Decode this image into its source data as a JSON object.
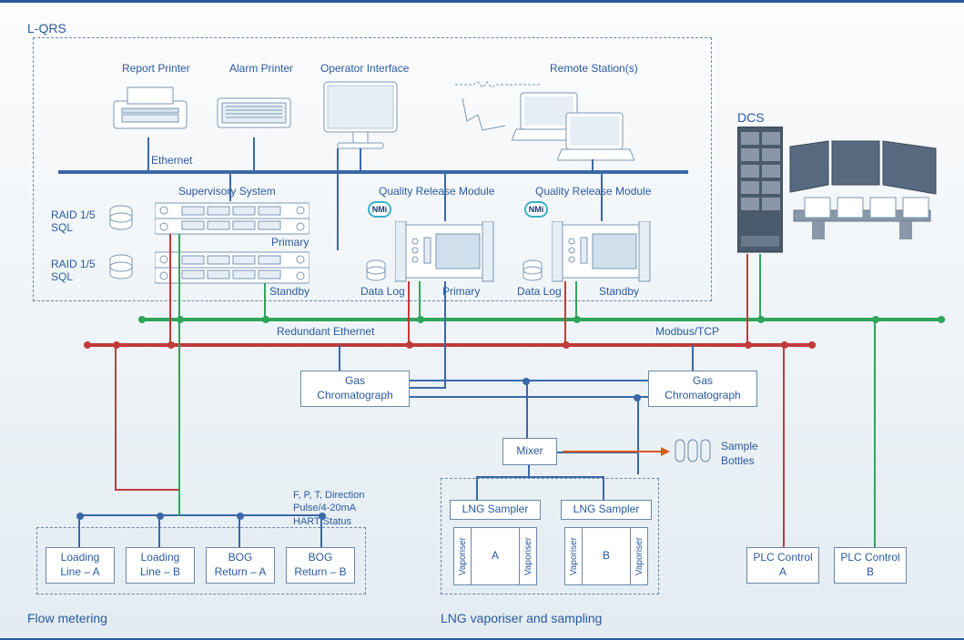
{
  "title": "L-QRS",
  "sections": {
    "lqrs": "L-QRS",
    "flow_metering": "Flow metering",
    "lng_vaporiser": "LNG vaporiser and sampling",
    "dcs": "DCS"
  },
  "top_equipment": {
    "report_printer": "Report Printer",
    "alarm_printer": "Alarm Printer",
    "operator_interface": "Operator Interface",
    "remote_stations": "Remote Station(s)"
  },
  "networks": {
    "ethernet": "Ethernet",
    "redundant_ethernet": "Redundant Ethernet",
    "modbus_tcp": "Modbus/TCP"
  },
  "supervisory": {
    "title": "Supervisory System",
    "raid": "RAID 1/5\nSQL",
    "primary": "Primary",
    "standby": "Standby"
  },
  "qrm": {
    "title": "Quality Release Module",
    "data_log": "Data Log",
    "primary": "Primary",
    "standby": "Standby"
  },
  "gas_chromatograph": "Gas\nChromatograph",
  "mixer": "Mixer",
  "lng_sampler": "LNG Sampler",
  "vaporiser": "Vaporiser",
  "sample_bottles": "Sample\nBottles",
  "signal_label": "F, P, T, Direction\nPulse/4-20mA\nHART/Status",
  "flow_boxes": {
    "loading_a": "Loading\nLine – A",
    "loading_b": "Loading\nLine – B",
    "bog_a": "BOG\nReturn – A",
    "bog_b": "BOG\nReturn – B"
  },
  "plc": {
    "a": "PLC Control\nA",
    "b": "PLC Control\nB"
  },
  "ab": {
    "a": "A",
    "b": "B"
  },
  "colors": {
    "brand": "#2a5a9e",
    "bus_blue": "#3a68a8",
    "bus_green": "#2fa55a",
    "bus_red": "#c23a3a",
    "box_border": "#6b87a8"
  }
}
